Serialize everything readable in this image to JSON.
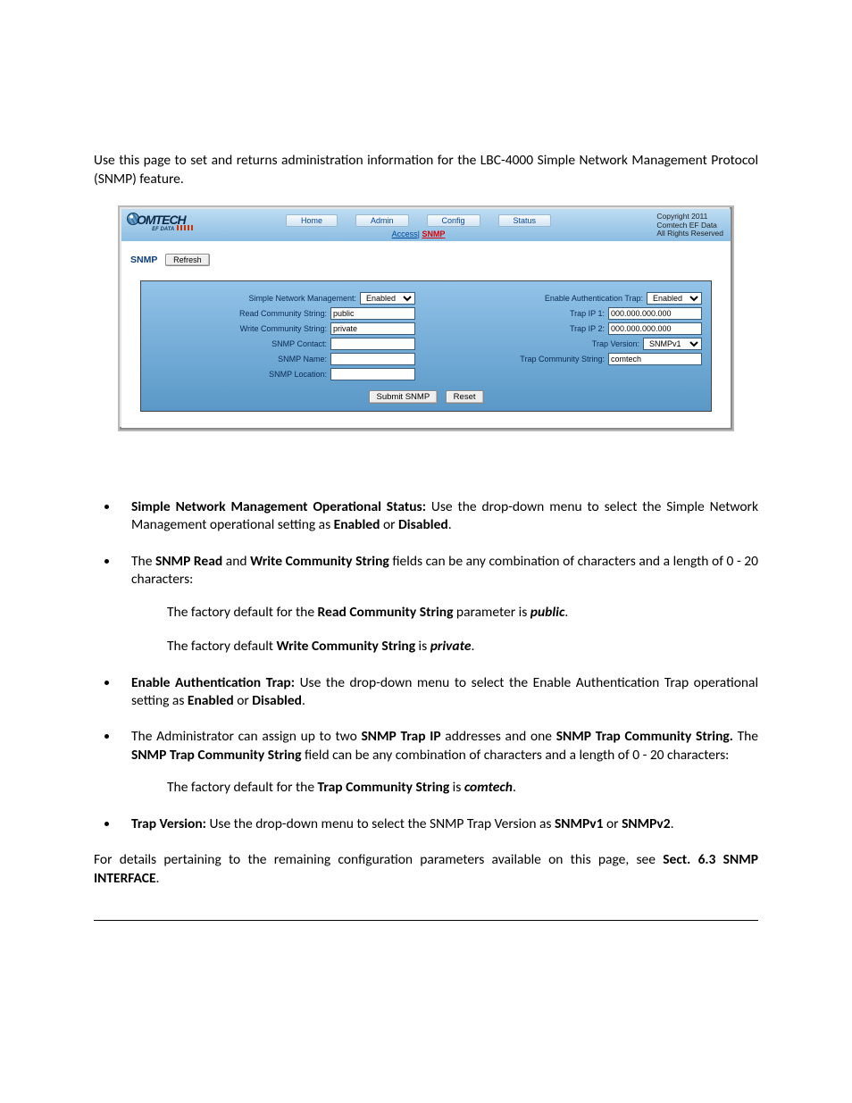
{
  "intro": "Use this page to set and returns administration information for the LBC-4000 Simple Network Management Protocol (SNMP) feature.",
  "panel": {
    "logo_text": "OMTECH",
    "logo_sub_prefix": "EF DATA",
    "nav": [
      "Home",
      "Admin",
      "Config",
      "Status"
    ],
    "breadcrumb": {
      "access": "Access",
      "sep": "|",
      "snmp": "SNMP"
    },
    "copyright_line1": "Copyright 2011",
    "copyright_line2": "Comtech EF Data",
    "copyright_line3": "All Rights Reserved",
    "page_label": "SNMP",
    "refresh_label": "Refresh",
    "left": {
      "l1": "Simple Network Management:",
      "l1_sel": "Enabled",
      "l2": "Read Community String:",
      "l2_val": "public",
      "l3": "Write Community String:",
      "l3_val": "private",
      "l4": "SNMP Contact:",
      "l4_val": "",
      "l5": "SNMP Name:",
      "l5_val": "",
      "l6": "SNMP Location:",
      "l6_val": ""
    },
    "right": {
      "r1": "Enable Authentication Trap:",
      "r1_sel": "Enabled",
      "r2": "Trap IP 1:",
      "r2_val": "000.000.000.000",
      "r3": "Trap IP 2:",
      "r3_val": "000.000.000.000",
      "r4": "Trap Version:",
      "r4_sel": "SNMPv1",
      "r5": "Trap Community String:",
      "r5_val": "comtech"
    },
    "submit_label": "Submit SNMP",
    "reset_label": "Reset"
  },
  "bul1_strong": "Simple Network Management Operational Status:",
  "bul1_rest_a": " Use the drop-down menu to select the Simple Network Management operational setting as ",
  "bul1_b1": "Enabled",
  "bul1_mid": " or ",
  "bul1_b2": "Disabled",
  "bul1_period": ".",
  "bul2_a": "The ",
  "bul2_b1": "SNMP Read",
  "bul2_mid1": " and ",
  "bul2_b2": "Write Community String",
  "bul2_rest": " fields can be any combination of characters and a length of 0 - 20 characters:",
  "sub2a_a": "The factory default for the ",
  "sub2a_b": "Read Community String",
  "sub2a_mid": " parameter is ",
  "sub2a_def": "public",
  "sub2a_period": ".",
  "sub2b_a": "The factory default ",
  "sub2b_b": "Write Community String",
  "sub2b_mid": " is ",
  "sub2b_def": "private",
  "sub2b_period": ".",
  "bul3_strong": "Enable Authentication Trap:",
  "bul3_rest": " Use the drop-down menu to select the Enable Authentication Trap operational setting as ",
  "bul3_b1": "Enabled",
  "bul3_mid": " or ",
  "bul3_b2": "Disabled",
  "bul3_period": ".",
  "bul4_a": "The Administrator can assign up to two ",
  "bul4_b1": "SNMP Trap IP",
  "bul4_mid1": " addresses and one ",
  "bul4_b2": "SNMP Trap Community String.",
  "bul4_mid2": " The ",
  "bul4_b3": "SNMP Trap Community String",
  "bul4_rest": " field can be any combination of characters and a length of 0 - 20 characters:",
  "sub4_a": "The factory default for the ",
  "sub4_b": "Trap Community String",
  "sub4_mid": " is ",
  "sub4_def": "comtech",
  "sub4_period": ".",
  "bul5_strong": "Trap Version:",
  "bul5_rest": " Use the drop-down menu to select the SNMP Trap Version as ",
  "bul5_b1": "SNMPv1",
  "bul5_mid": " or ",
  "bul5_b2": "SNMPv2",
  "bul5_period": ".",
  "closing_a": "For details pertaining to the remaining configuration parameters available on this page, see ",
  "closing_b": "Sect. 6.3 SNMP INTERFACE",
  "closing_period": "."
}
